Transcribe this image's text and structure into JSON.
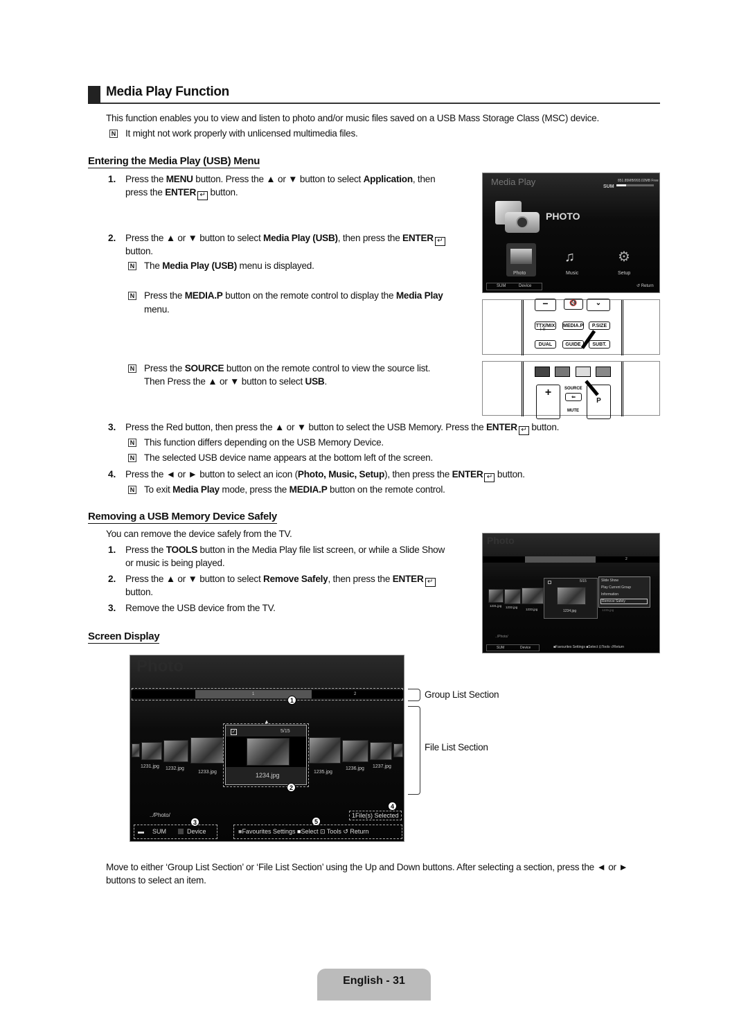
{
  "title": "Media Play Function",
  "intro": "This function enables you to view and listen to photo and/or music files saved on a USB Mass Storage Class (MSC) device.",
  "intro_note": "It might not work properly with unlicensed multimedia files.",
  "note_icon": "N",
  "enter_icon": "↵",
  "s1": {
    "heading": "Entering the Media Play (USB) Menu",
    "step1_num": "1.",
    "step1_a": "Press the ",
    "step1_b": "MENU",
    "step1_c": " button. Press the ▲ or ▼ button to select ",
    "step1_d": "Application",
    ", then": "",
    "step1_e": ", then",
    "step1_f": "press the ",
    "step1_g": "ENTER",
    "step1_h": " button.",
    "step2_num": "2.",
    "step2_a": "Press the ▲ or ▼ button to select ",
    "step2_b": "Media Play (USB)",
    "step2_c": ", then press the ",
    "step2_d": "ENTER",
    "step2_e": "button.",
    "note1_a": "The ",
    "note1_b": "Media Play (USB)",
    "note1_c": " menu is displayed.",
    "note2_a": "Press the ",
    "note2_b": "MEDIA.P",
    "note2_c": " button on the remote control to display the ",
    "note2_d": "Media Play",
    "note2_e": "menu.",
    "note3_a": "Press the ",
    "note3_b": "SOURCE",
    "note3_c": " button on the remote control to view the source list.",
    "note3_d": "Then Press the ▲ or ▼ button to select ",
    "note3_e": "USB",
    "step3_num": "3.",
    "step3_a": "Press the Red button, then press the ▲ or ▼ button to select the USB Memory. Press the ",
    "step3_b": "ENTER",
    "step3_c": " button.",
    "note4": "This function differs depending on the USB Memory Device.",
    "note5": "The selected USB device name appears at the bottom left of the screen.",
    "step4_num": "4.",
    "step4_a": "Press the ◄ or ► button to select an icon (",
    "step4_b": "Photo, Music, Setup",
    "step4_c": "), then press the ",
    "step4_d": "ENTER",
    "step4_e": " button.",
    "note6_a": "To exit ",
    "note6_b": "Media Play",
    "note6_c": " mode, press the ",
    "note6_d": "MEDIA.P",
    "note6_e": " button on the remote control."
  },
  "s2": {
    "heading": "Removing a USB Memory Device Safely",
    "intro": "You can remove the device safely from the TV.",
    "step1_num": "1.",
    "step1_a": "Press the ",
    "step1_b": "TOOLS",
    "step1_c": " button in the Media Play file list screen, or while a Slide Show",
    "step1_d": "or music is being played.",
    "step2_num": "2.",
    "step2_a": "Press the ▲ or ▼ button to select ",
    "step2_b": "Remove Safely",
    "step2_c": ", then press the ",
    "step2_d": "ENTER",
    "step2_e": "button.",
    "step3_num": "3.",
    "step3_a": "Remove the USB device from the TV."
  },
  "s3": {
    "heading": "Screen Display",
    "group_label": "Group List Section",
    "file_label": "File List Section",
    "footer_a": "Move to either ‘Group List Section’ or ‘File List Section’ using the Up and Down buttons. After selecting a section, press the ◄ or ►",
    "footer_b": "buttons to select an item."
  },
  "mediaplay_screen": {
    "title": "Media Play",
    "device": "SUM",
    "free": "851.85MB/993.02MB Free",
    "big_label": "PHOTO",
    "items": [
      "Photo",
      "Music",
      "Setup"
    ],
    "bottom_sum": "SUM",
    "bottom_device": "Device",
    "return": "Return"
  },
  "remote1": {
    "keys": [
      "TTX/MIX",
      "MEDIA.P",
      "P.SIZE",
      "DUAL",
      "GUIDE",
      "SUBT."
    ],
    "sub": "I-II"
  },
  "remote2": {
    "source": "SOURCE",
    "mute": "MUTE",
    "p": "P",
    "plus": "+"
  },
  "photo_small": {
    "title": "Photo",
    "group2": "2",
    "counter": "5/15",
    "center_file": "1234.jpg",
    "files": [
      "1231.jpg",
      "1232.jpg",
      "1233.jpg",
      "1235.jpg"
    ],
    "path": "../Photo/",
    "menu": [
      "Slide Show",
      "Play Current Group",
      "Information",
      "Remove Safely"
    ],
    "sum": "SUM",
    "device": "Device",
    "fav": "Favourites Settings",
    "select": "Select",
    "tools": "Tools",
    "return": "Return"
  },
  "photo_big": {
    "title": "Photo",
    "group1": "1",
    "group2": "2",
    "counter": "5/15",
    "center_file": "1234.jpg",
    "files": [
      "1231.jpg",
      "1232.jpg",
      "1233.jpg",
      "1235.jpg",
      "1236.jpg",
      "1237.jpg"
    ],
    "path": "../Photo/",
    "selected": "1File(s) Selected",
    "sum": "SUM",
    "device": "Device",
    "fav": "Favourites Settings",
    "select": "Select",
    "tools": "Tools",
    "return": "Return",
    "callouts": [
      "1",
      "2",
      "3",
      "4",
      "5"
    ]
  },
  "page_label": "English - 31"
}
